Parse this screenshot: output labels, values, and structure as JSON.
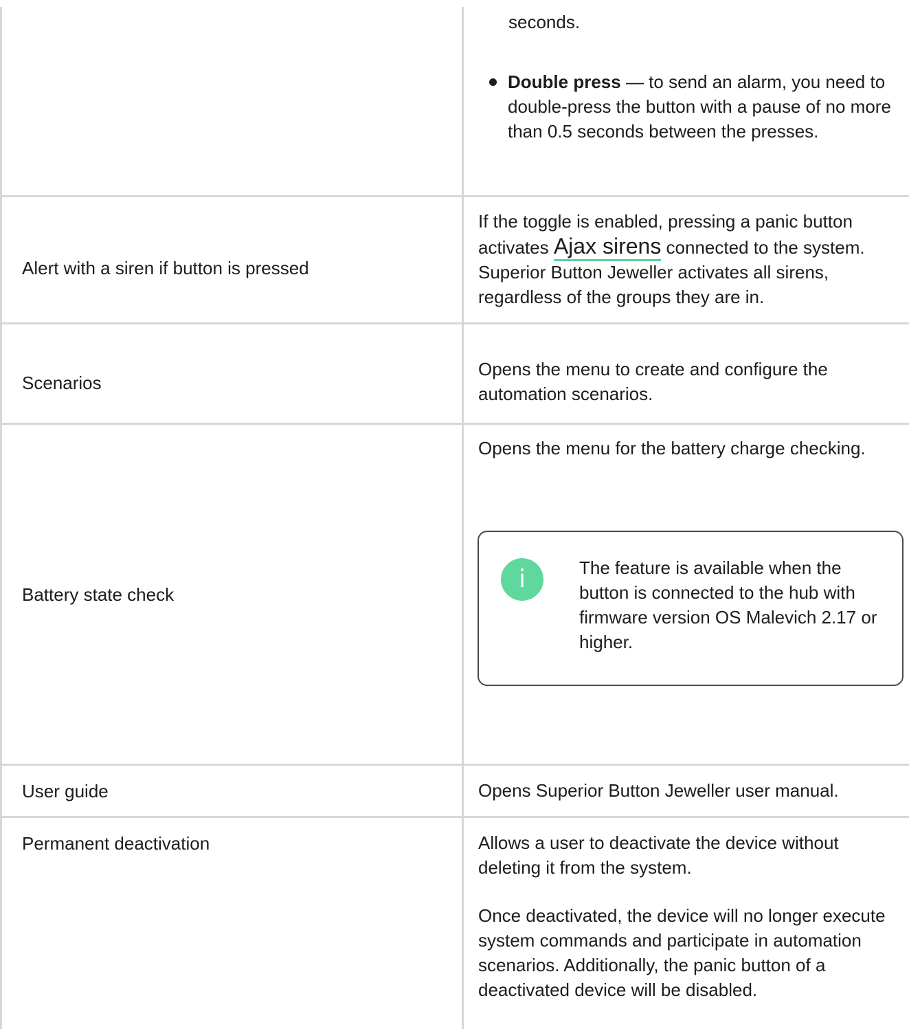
{
  "rows": {
    "press_mode": {
      "top_fragment": "seconds.",
      "bullet": {
        "bold": "Double press",
        "text": " — to send an alarm, you need to double-press the button with a pause of no more than 0.5 seconds between the presses."
      }
    },
    "siren": {
      "setting": "Alert with a siren if button is pressed",
      "desc_before": "If the toggle is enabled, pressing a panic button activates ",
      "link": "Ajax sirens",
      "desc_after": " connected to the system. Superior Button Jeweller activates all sirens, regardless of the groups they are in."
    },
    "scenarios": {
      "setting": "Scenarios",
      "desc": "Opens the menu to create and configure the automation scenarios."
    },
    "battery": {
      "setting": "Battery state check",
      "desc": "Opens the menu for the battery charge checking.",
      "info_icon": "i",
      "info_text": "The feature is available when the button is connected to the hub with firmware version OS Malevich 2.17 or higher."
    },
    "user_guide": {
      "setting": "User guide",
      "desc": "Opens Superior Button Jeweller user manual."
    },
    "deactivation": {
      "setting": "Permanent deactivation",
      "desc1": "Allows a user to deactivate the device without deleting it from the system.",
      "desc2": "Once deactivated, the device will no longer execute system commands and participate in automation scenarios. Additionally, the panic button of a deactivated device will be disabled."
    }
  },
  "colors": {
    "text": "#1d1d1f",
    "border": "#d7d7d7",
    "accent": "#5ed89c",
    "link_underline": "#5ad29b"
  }
}
